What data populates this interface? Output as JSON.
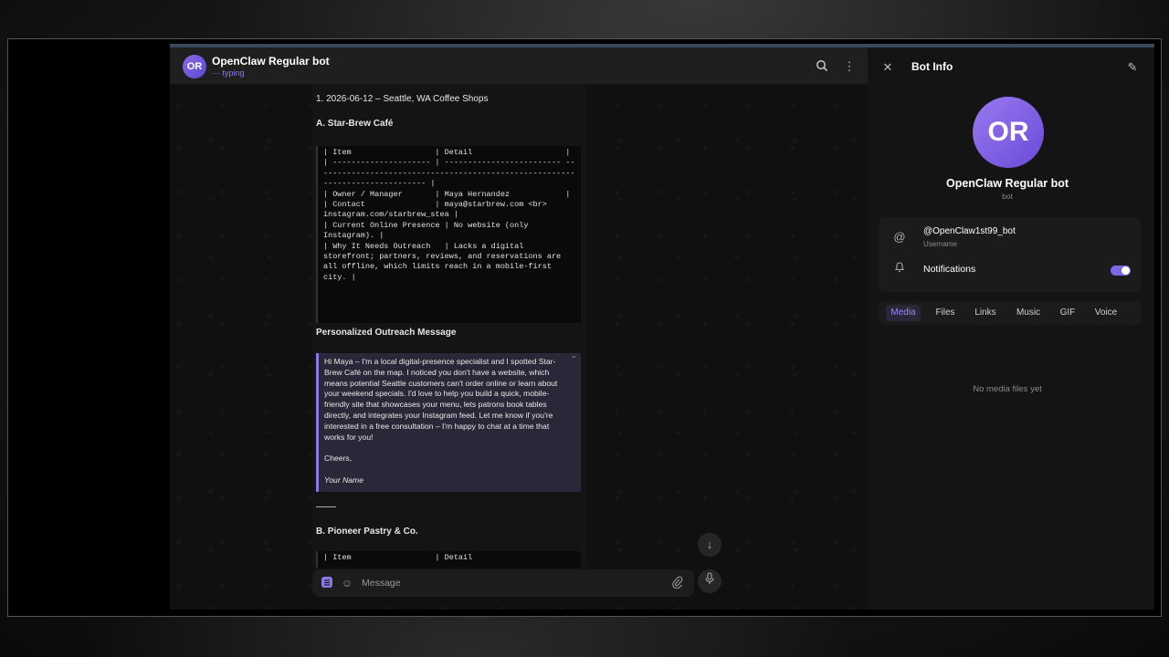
{
  "chat": {
    "header": {
      "avatar_initials": "OR",
      "title": "OpenClaw Regular bot",
      "status": "··· typing"
    },
    "messages": {
      "heading1": "1. 2026-06-12 – Seattle, WA Coffee Shops",
      "heading2": "A. Star-Brew Café",
      "table_a": "| Item                  | Detail                    |\n| --------------------- | ------------------------- ------------------------------------------------------------------------------ |\n| Owner / Manager       | Maya Hernandez            |\n| Contact               | maya@starbrew.com <br> instagram.com/starbrew_stea |\n| Current Online Presence | No website (only Instagram). |\n| Why It Needs Outreach   | Lacks a digital storefront; partners, reviews, and reservations are all offline, which limits reach in a mobile-first city. |",
      "outreach_heading": "Personalized Outreach Message",
      "quote_mark": "\"",
      "quote_body": "Hi Maya – I'm a local digital-presence specialist and I spotted Star-Brew Café on the map. I noticed you don't have a website, which means potential Seattle customers can't order online or learn about your weekend specials. I'd love to help you build a quick, mobile-friendly site that showcases your menu, lets patrons book tables directly, and integrates your Instagram feed. Let me know if you're interested in a free consultation – I'm happy to chat at a time that works for you!",
      "quote_signoff": "Cheers,",
      "quote_name": "Your Name",
      "heading3": "B. Pioneer Pastry & Co.",
      "table_b_start": "| Item                  | Detail"
    },
    "composer": {
      "placeholder": "Message"
    }
  },
  "info": {
    "title": "Bot Info",
    "avatar_initials": "OR",
    "bot_name": "OpenClaw Regular bot",
    "bot_sub": "bot",
    "username": "@OpenClaw1st99_bot",
    "username_label": "Username",
    "notifications_label": "Notifications",
    "notifications_on": true,
    "tabs": [
      {
        "label": "Media",
        "active": true
      },
      {
        "label": "Files",
        "active": false
      },
      {
        "label": "Links",
        "active": false
      },
      {
        "label": "Music",
        "active": false
      },
      {
        "label": "GIF",
        "active": false
      },
      {
        "label": "Voice",
        "active": false
      }
    ],
    "empty_text": "No media files yet"
  },
  "colors": {
    "accent": "#8a7ae8",
    "panel": "#141414",
    "header": "#1f1f1f"
  }
}
